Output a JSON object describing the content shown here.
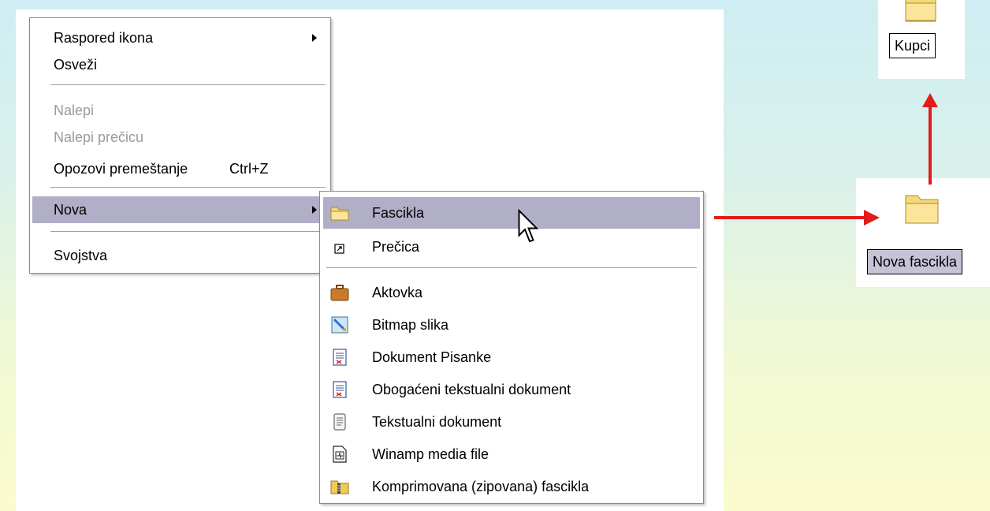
{
  "context_menu": {
    "items": [
      {
        "label": "Raspored ikona",
        "submenu": true,
        "disabled": false
      },
      {
        "label": "Osveži",
        "disabled": false
      },
      {
        "label": "Nalepi",
        "disabled": true
      },
      {
        "label": "Nalepi prečicu",
        "disabled": true
      },
      {
        "label": "Opozovi premeštanje",
        "shortcut": "Ctrl+Z",
        "disabled": false
      },
      {
        "label": "Nova",
        "submenu": true,
        "highlighted": true
      },
      {
        "label": "Svojstva",
        "disabled": false
      }
    ]
  },
  "new_submenu": {
    "items": [
      {
        "label": "Fascikla",
        "icon": "folder-icon",
        "highlighted": true
      },
      {
        "label": "Prečica",
        "icon": "shortcut-icon"
      },
      {
        "label": "Aktovka",
        "icon": "briefcase-icon"
      },
      {
        "label": "Bitmap slika",
        "icon": "bitmap-icon"
      },
      {
        "label": "Dokument Pisanke",
        "icon": "wordpad-icon"
      },
      {
        "label": "Obogaćeni tekstualni dokument",
        "icon": "rich-text-icon"
      },
      {
        "label": "Tekstualni dokument",
        "icon": "text-document-icon"
      },
      {
        "label": "Winamp media file",
        "icon": "winamp-icon"
      },
      {
        "label": "Komprimovana (zipovana) fascikla",
        "icon": "zip-folder-icon"
      }
    ]
  },
  "desktop": {
    "new_folder_label": "Nova fascikla",
    "renamed_folder_label": "Kupci"
  },
  "colors": {
    "highlight": "#b1aec7",
    "arrow": "#e21b1b",
    "folder": "#f5d878"
  }
}
